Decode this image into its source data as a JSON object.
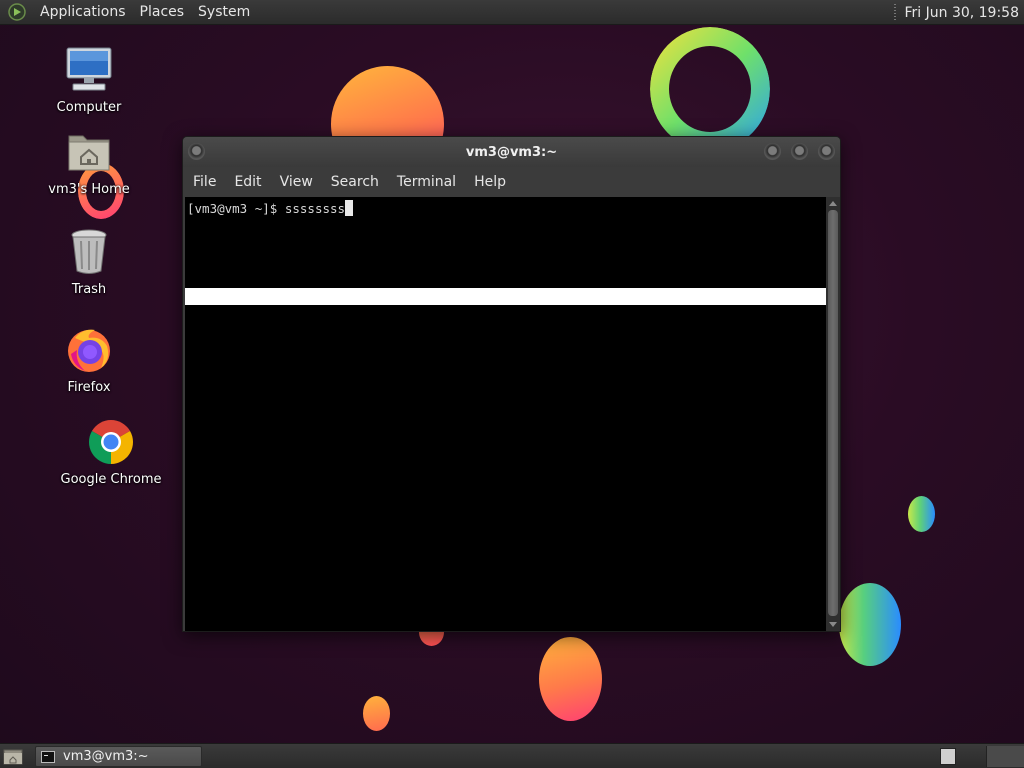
{
  "top_panel": {
    "menus": [
      "Applications",
      "Places",
      "System"
    ],
    "clock": "Fri Jun 30, 19:58"
  },
  "desktop": {
    "icons": [
      {
        "label": "Computer",
        "icon": "computer-icon"
      },
      {
        "label": "vm3's Home",
        "icon": "home-folder-icon"
      },
      {
        "label": "Trash",
        "icon": "trash-icon"
      },
      {
        "label": "Firefox",
        "icon": "firefox-icon"
      },
      {
        "label": "Google Chrome",
        "icon": "chrome-icon"
      }
    ]
  },
  "terminal": {
    "title": "vm3@vm3:~",
    "menus": [
      "File",
      "Edit",
      "View",
      "Search",
      "Terminal",
      "Help"
    ],
    "prompt": "[vm3@vm3 ~]$ ",
    "input": "ssssssss"
  },
  "bottom_panel": {
    "task_label": "vm3@vm3:~"
  },
  "colors": {
    "panel": "#2b2b2b",
    "terminal_bg": "#000000",
    "wallpaper": "#2a0c24"
  }
}
